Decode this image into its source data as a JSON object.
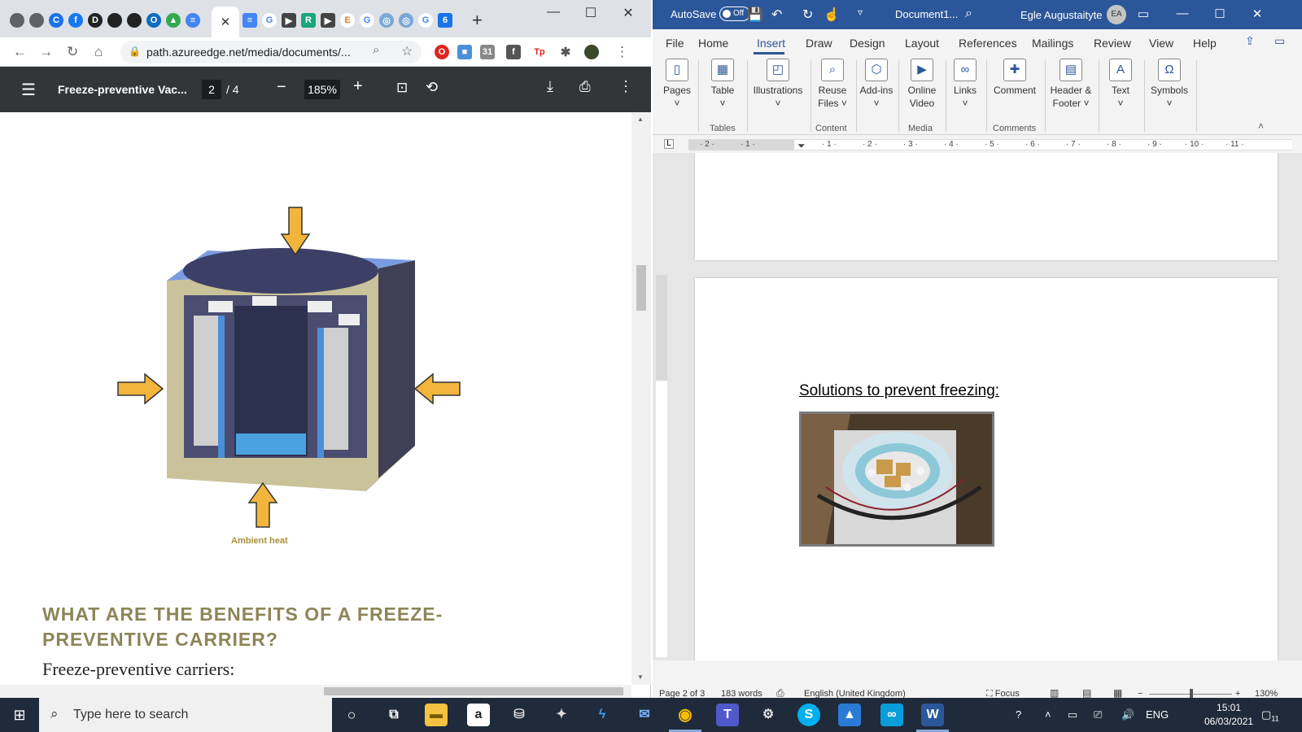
{
  "chrome": {
    "url": "path.azureedge.net/media/documents/...",
    "tab_close": "✕",
    "new_tab": "+",
    "tab_icons": [
      {
        "name": "settings",
        "glyph": "",
        "color": "#5f6368"
      },
      {
        "name": "settings",
        "glyph": "",
        "color": "#5f6368"
      },
      {
        "name": "c",
        "glyph": "C",
        "color": "#1a73e8"
      },
      {
        "name": "facebook",
        "glyph": "f",
        "color": "#1877f2"
      },
      {
        "name": "d",
        "glyph": "D",
        "color": "#222222"
      },
      {
        "name": "github",
        "glyph": "",
        "color": "#222222"
      },
      {
        "name": "github",
        "glyph": "",
        "color": "#222222"
      },
      {
        "name": "outlook",
        "glyph": "O",
        "color": "#0f6cbd"
      },
      {
        "name": "drive",
        "glyph": "▲",
        "color": "#34a853"
      },
      {
        "name": "docs",
        "glyph": "≡",
        "color": "#4285f4"
      }
    ]
  },
  "pdf": {
    "title": "Freeze-preventive Vac...",
    "page_current": "2",
    "page_total": "/ 4",
    "zoom": "185%",
    "ambient_label": "Ambient heat",
    "heading": "What are the benefits of a freeze-preventive carrier?",
    "body_start": "Freeze-preventive carriers:"
  },
  "word": {
    "autosave": "AutoSave",
    "autosave_state": "Off",
    "doc_name": "Document1...",
    "user_name": "Egle Augustaityte",
    "user_initials": "EA",
    "tabs": [
      "File",
      "Home",
      "Insert",
      "Draw",
      "Design",
      "Layout",
      "References",
      "Mailings",
      "Review",
      "View",
      "Help"
    ],
    "ribbon": {
      "pages": "Pages",
      "table": "Table",
      "illustrations": "Illustrations",
      "reuse_files": "Reuse Files",
      "add_ins": "Add-ins",
      "online_video": "Online Video",
      "links": "Links",
      "comment": "Comment",
      "header_footer": "Header & Footer",
      "text": "Text",
      "symbols": "Symbols",
      "group_tables": "Tables",
      "group_content": "Content",
      "group_media": "Media",
      "group_comments": "Comments"
    },
    "doc_heading": "Solutions to prevent freezing:",
    "status": {
      "page": "Page 2 of 3",
      "words": "183 words",
      "language": "English (United Kingdom)",
      "focus": "Focus",
      "zoom": "130%"
    }
  },
  "taskbar": {
    "search_placeholder": "Type here to search",
    "language": "ENG",
    "time": "15:01",
    "date": "06/03/2021",
    "notifications": "11"
  }
}
